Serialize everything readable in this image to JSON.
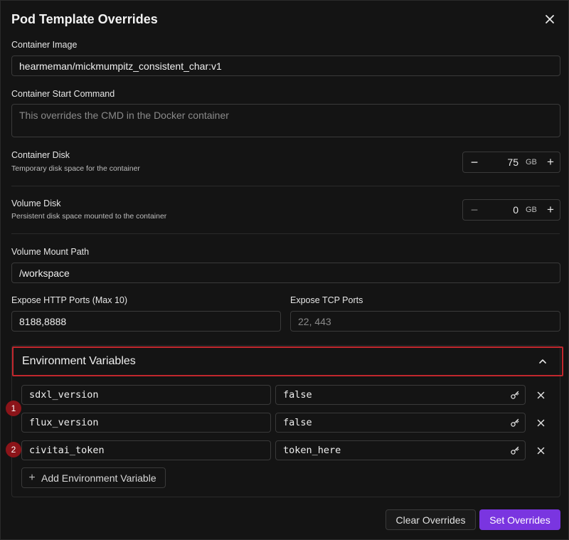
{
  "dialog": {
    "title": "Pod Template Overrides"
  },
  "container_image": {
    "label": "Container Image",
    "value": "hearmeman/mickmumpitz_consistent_char:v1"
  },
  "start_command": {
    "label": "Container Start Command",
    "placeholder": "This overrides the CMD in the Docker container"
  },
  "container_disk": {
    "label": "Container Disk",
    "description": "Temporary disk space for the container",
    "value": "75",
    "unit": "GB",
    "minus": "−",
    "plus": "+"
  },
  "volume_disk": {
    "label": "Volume Disk",
    "description": "Persistent disk space mounted to the container",
    "value": "0",
    "unit": "GB",
    "minus": "−",
    "plus": "+"
  },
  "volume_mount": {
    "label": "Volume Mount Path",
    "value": "/workspace"
  },
  "http_ports": {
    "label": "Expose HTTP Ports (Max 10)",
    "value": "8188,8888"
  },
  "tcp_ports": {
    "label": "Expose TCP Ports",
    "placeholder": "22, 443"
  },
  "env": {
    "header": "Environment Variables",
    "variables": [
      {
        "key": "sdxl_version",
        "value": "false",
        "badge": "1"
      },
      {
        "key": "flux_version",
        "value": "false",
        "badge": ""
      },
      {
        "key": "civitai_token",
        "value": "token_here",
        "badge": "2"
      }
    ],
    "add_label": "Add Environment Variable"
  },
  "footer": {
    "clear_label": "Clear Overrides",
    "set_label": "Set Overrides"
  },
  "colors": {
    "accent": "#7a35e0",
    "highlight": "#c1272d",
    "badge": "#8b1419"
  }
}
